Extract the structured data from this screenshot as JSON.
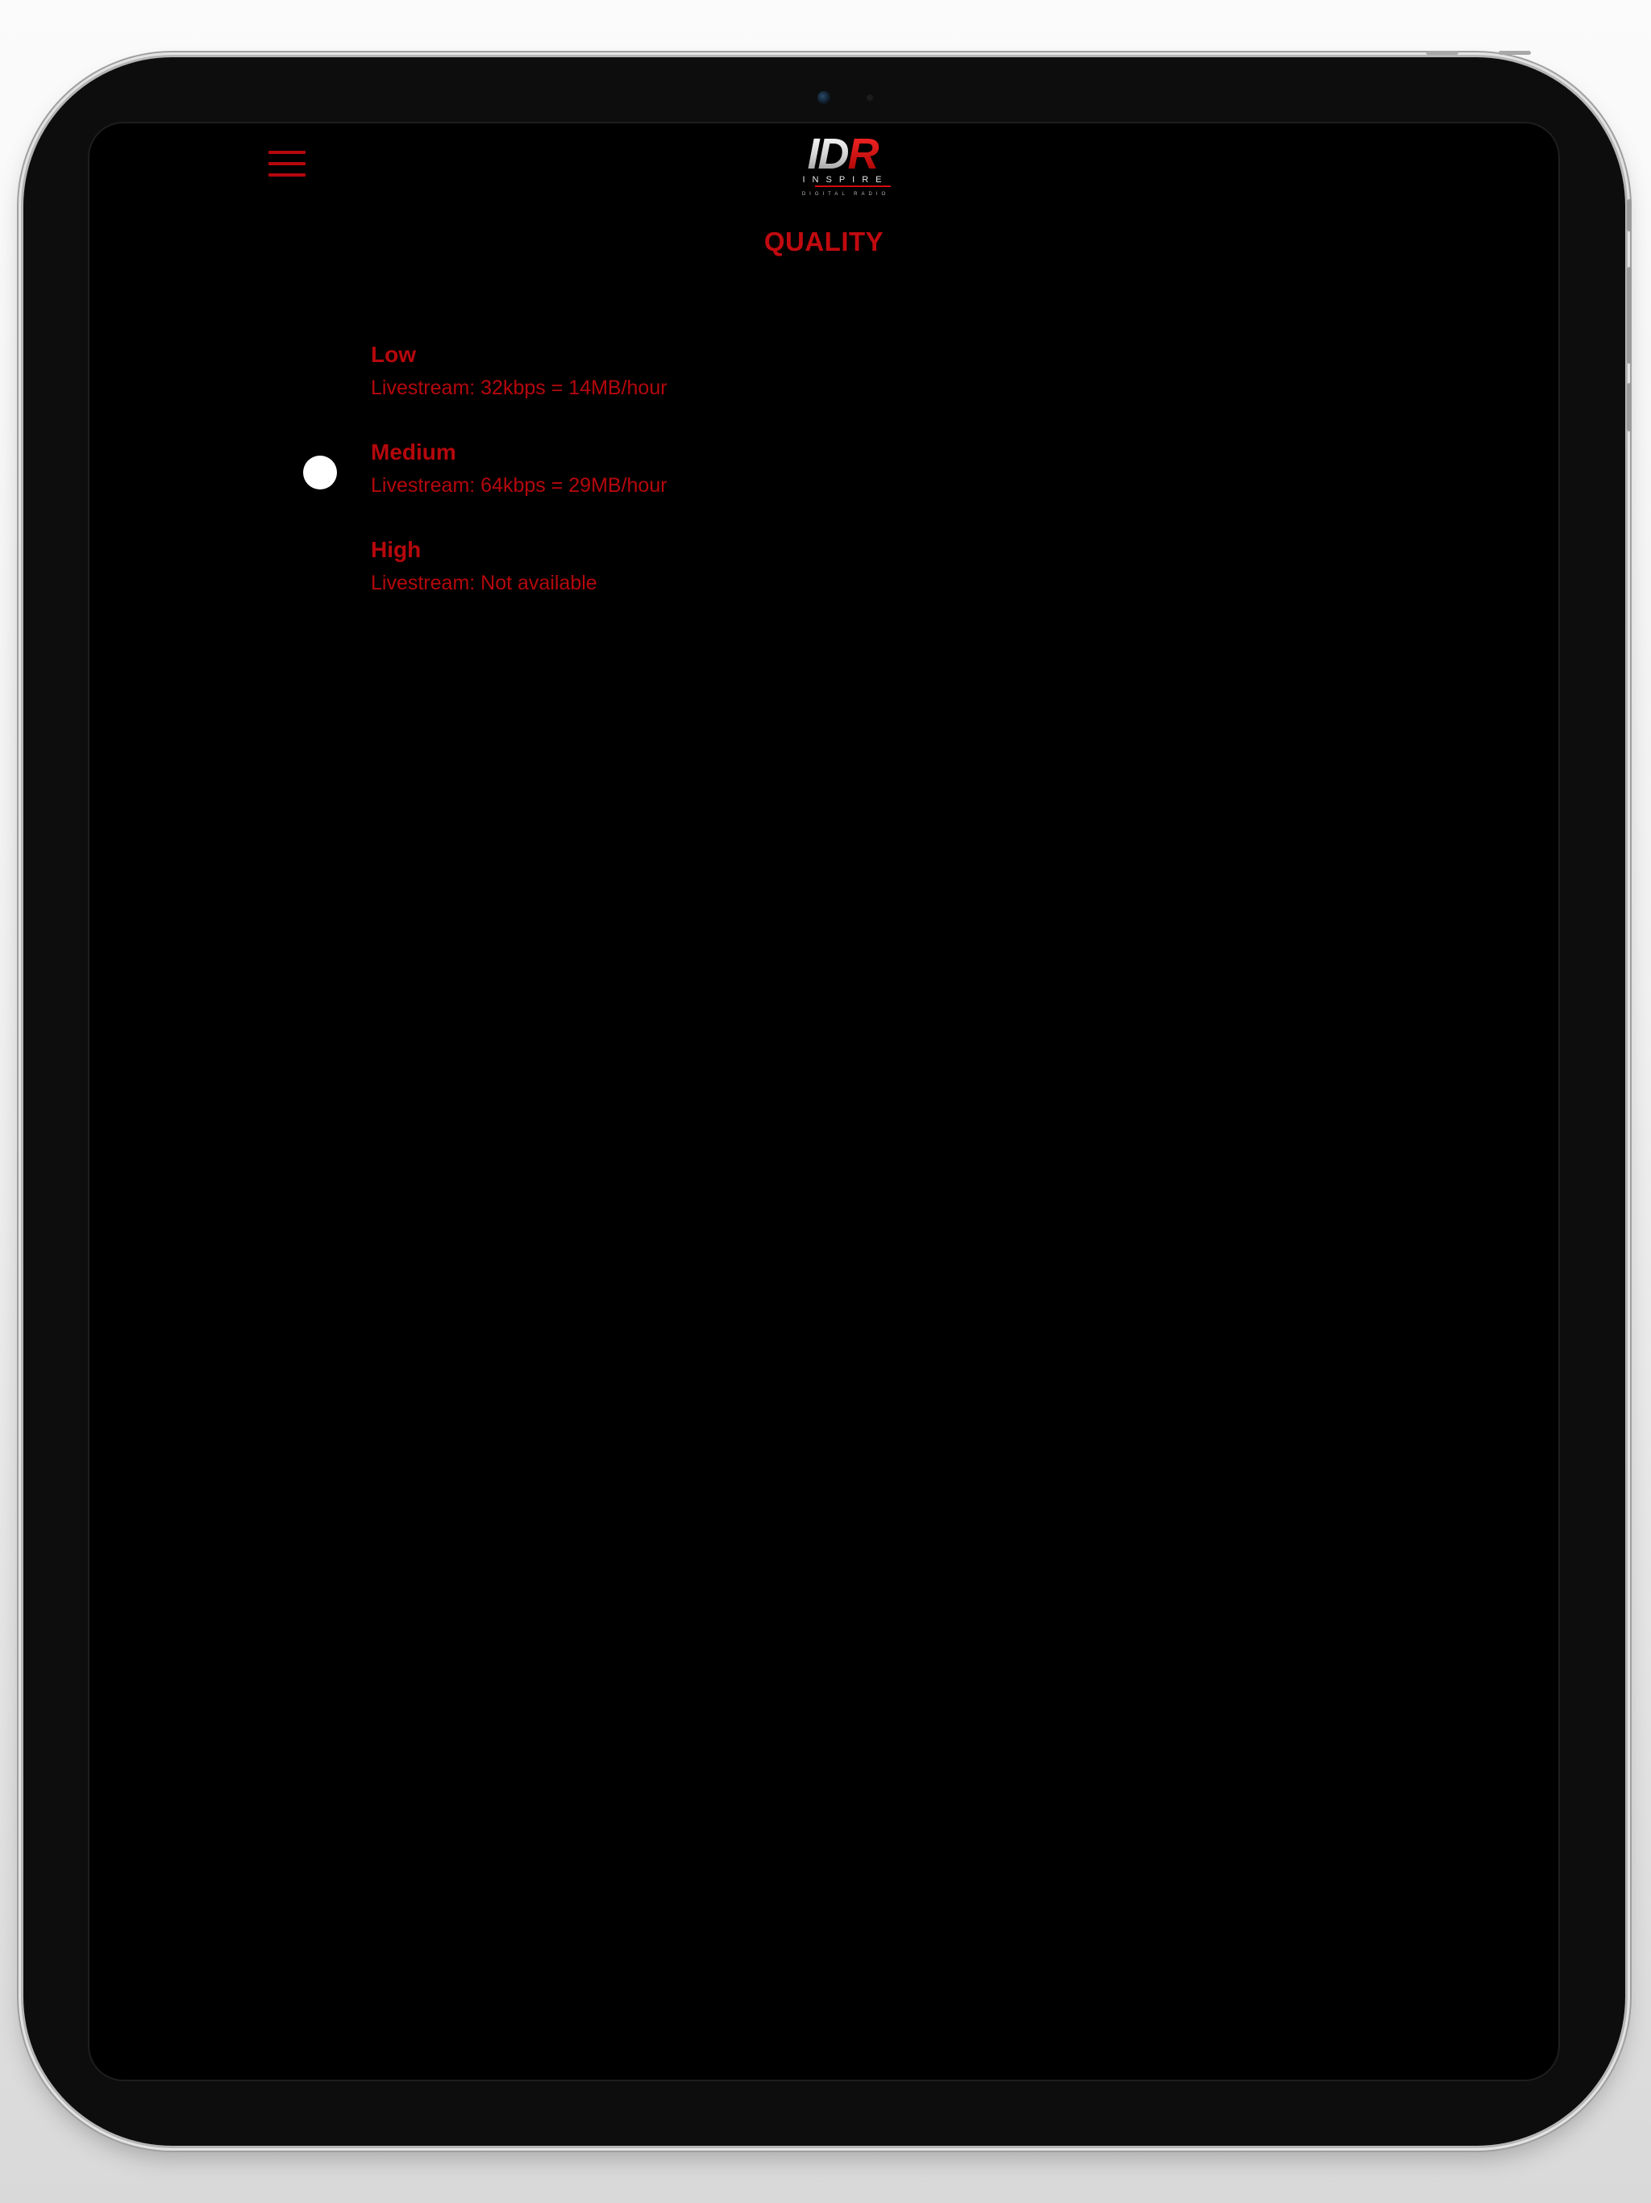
{
  "header": {
    "menu_icon": "hamburger-menu-icon",
    "logo": {
      "main": "IDR",
      "subtitle": "INSPIRE",
      "tagline": "DIGITAL RADIO"
    },
    "title": "QUALITY"
  },
  "quality": {
    "selected": "Medium",
    "options": [
      {
        "label": "Low",
        "description": "Livestream: 32kbps = 14MB/hour",
        "selected": false
      },
      {
        "label": "Medium",
        "description": "Livestream: 64kbps = 29MB/hour",
        "selected": true
      },
      {
        "label": "High",
        "description": "Livestream: Not available",
        "selected": false
      }
    ]
  },
  "colors": {
    "accent": "#c00a0f",
    "background": "#000000",
    "radio_selected": "#ffffff"
  }
}
